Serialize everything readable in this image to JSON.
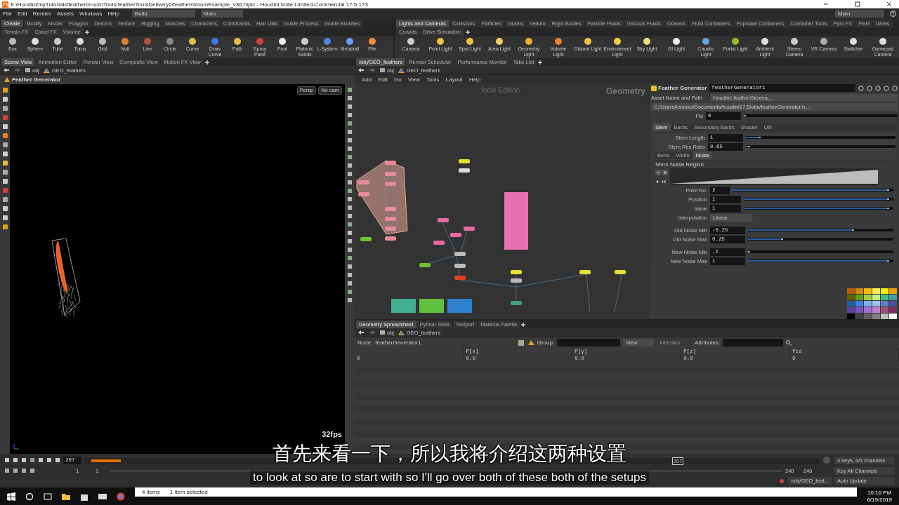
{
  "window": {
    "title": "E:/Houdini/myTutorials/featherGroomTools/featherToolsDelivery2/featherGroomExample_v36.hiplc - Houdini Indie Limited-Commercial 17.5.173"
  },
  "menu": [
    "File",
    "Edit",
    "Render",
    "Assets",
    "Windows",
    "Help"
  ],
  "desks": {
    "build": "Build",
    "main": "Main",
    "right": "Main"
  },
  "shelves": [
    {
      "tabs": [
        {
          "label": "Create",
          "selected": true
        },
        {
          "label": "Modify",
          "selected": false
        },
        {
          "label": "Model",
          "selected": false
        },
        {
          "label": "Polygon",
          "selected": false
        },
        {
          "label": "Deform",
          "selected": false
        },
        {
          "label": "Texture",
          "selected": false
        },
        {
          "label": "Rigging",
          "selected": false
        },
        {
          "label": "Muscles",
          "selected": false
        },
        {
          "label": "Characters",
          "selected": false
        },
        {
          "label": "Constraints",
          "selected": false
        },
        {
          "label": "Hair Utils",
          "selected": false
        },
        {
          "label": "Guide Process",
          "selected": false
        },
        {
          "label": "Guide Brushes",
          "selected": false
        },
        {
          "label": "Terrain FX",
          "selected": false
        },
        {
          "label": "Cloud FX",
          "selected": false
        },
        {
          "label": "Volume",
          "selected": false
        }
      ],
      "tools": [
        "Box",
        "Sphere",
        "Tube",
        "Torus",
        "Grid",
        "Null",
        "Line",
        "Circle",
        "Curve",
        "Draw Curve",
        "Path",
        "Spray Paint",
        "Font",
        "Platonic Solids",
        "L-System",
        "Metaball",
        "File"
      ]
    },
    {
      "tabs": [
        {
          "label": "Lights and Cameras",
          "selected": true
        },
        {
          "label": "Collisions",
          "selected": false
        },
        {
          "label": "Particles",
          "selected": false
        },
        {
          "label": "Grains",
          "selected": false
        },
        {
          "label": "Vellum",
          "selected": false
        },
        {
          "label": "Rigid Bodies",
          "selected": false
        },
        {
          "label": "Particle Fluids",
          "selected": false
        },
        {
          "label": "Viscous Fluids",
          "selected": false
        },
        {
          "label": "Oceans",
          "selected": false
        },
        {
          "label": "Fluid Containers",
          "selected": false
        },
        {
          "label": "Populate Containers",
          "selected": false
        },
        {
          "label": "Container Tools",
          "selected": false
        },
        {
          "label": "Pyro FX",
          "selected": false
        },
        {
          "label": "FEM",
          "selected": false
        },
        {
          "label": "Wires",
          "selected": false
        },
        {
          "label": "Crowds",
          "selected": false
        },
        {
          "label": "Drive Simulation",
          "selected": false
        }
      ],
      "tools": [
        "Camera",
        "Point Light",
        "Spot Light",
        "Area Light",
        "Geometry Light",
        "Volume Light",
        "Distant Light",
        "Environment Light",
        "Sky Light",
        "GI Light",
        "Caustic Light",
        "Portal Light",
        "Ambient Light",
        "Stereo Camera",
        "VR Camera",
        "Switcher",
        "Gamepad Camera"
      ]
    }
  ],
  "viewer": {
    "tabs": [
      {
        "label": "Scene View",
        "selected": true
      },
      {
        "label": "Animation Editor",
        "selected": false
      },
      {
        "label": "Render View",
        "selected": false
      },
      {
        "label": "Composite View",
        "selected": false
      },
      {
        "label": "Motion FX View",
        "selected": false
      }
    ],
    "path": [
      "obj",
      "GEO_feathers"
    ],
    "title": "Feather Generator",
    "camera": "Persp",
    "camera_menu": "No cam",
    "fps": "32fps"
  },
  "network": {
    "tabs": [
      {
        "label": "/obj/GEO_feathers",
        "selected": true
      },
      {
        "label": "Render Scheduler",
        "selected": false
      },
      {
        "label": "Performance Monitor",
        "selected": false
      },
      {
        "label": "Take List",
        "selected": false
      }
    ],
    "path": [
      "obj",
      "GEO_feathers"
    ],
    "menu": [
      "Add",
      "Edit",
      "Go",
      "View",
      "Tools",
      "Layout",
      "Help"
    ],
    "edition": "Indie Edition",
    "context": "Geometry"
  },
  "parameters": {
    "type": "Feather Generator",
    "name": "featherGenerator1",
    "asset": {
      "label": "Asset Name and Path",
      "name": "Houdini::featherGenera...",
      "path": "C:/Users/bsooko/Documents/houdini17.5/otls/featherGenerator.h..."
    },
    "fid": {
      "label": "Fid",
      "value": "0",
      "level": 0
    },
    "tabs": [
      {
        "label": "Stem",
        "selected": true
      },
      {
        "label": "Barbs",
        "selected": false
      },
      {
        "label": "Secondary Barbs",
        "selected": false
      },
      {
        "label": "Shader",
        "selected": false
      },
      {
        "label": "Util",
        "selected": false
      }
    ],
    "stem": [
      {
        "label": "Stem Length",
        "value": "1",
        "level": 0.1
      },
      {
        "label": "Stem Res Ratio",
        "value": "0.65",
        "level": 0.03
      }
    ],
    "subtabs": [
      {
        "label": "Bend",
        "selected": false
      },
      {
        "label": "Width",
        "selected": false
      },
      {
        "label": "Noise",
        "selected": true
      }
    ],
    "ramp": {
      "label": "Stem Noise Region"
    },
    "ramp_fields": [
      {
        "label": "Point No.",
        "value": "2",
        "level": 1
      },
      {
        "label": "Position",
        "value": "1",
        "level": 1
      },
      {
        "label": "Value",
        "value": "1",
        "level": 1
      }
    ],
    "interpolation": {
      "label": "Interpolation",
      "value": "Linear"
    },
    "noise": [
      {
        "label": "Old Noise Min",
        "value": "-0.25",
        "level": 0.75
      },
      {
        "label": "Old Noise Max",
        "value": "0.25",
        "level": 0.25
      },
      {
        "label": "New Noise Min",
        "value": "-1",
        "level": 0
      },
      {
        "label": "New Noise Max",
        "value": "1",
        "level": 1
      }
    ]
  },
  "spreadsheet": {
    "tabs": [
      {
        "label": "Geometry Spreadsheet",
        "selected": true
      },
      {
        "label": "Python Shell",
        "selected": false
      },
      {
        "label": "Textport",
        "selected": false
      },
      {
        "label": "Material Palette",
        "selected": false
      }
    ],
    "path": [
      "obj",
      "GEO_feathers"
    ],
    "node_label": "Node:",
    "node": "featherGenerator1",
    "group_label": "Group:",
    "view": "View",
    "intrinsics": "Intrinsics",
    "attributes_label": "Attributes:",
    "columns": [
      "P[x]",
      "P[y]",
      "P[z]",
      "fid"
    ],
    "rows": [
      {
        "index": "0",
        "cells": [
          "0.0",
          "0.0",
          "0.0",
          "0"
        ]
      }
    ]
  },
  "timeline": {
    "frame": "207",
    "marker": "207",
    "start": "1",
    "start_field": "1",
    "end": "240",
    "end_field": "240",
    "keys": "4 keys, 4/4 channels",
    "key_all": "Key All Channels",
    "path": "/obj/GEO_feat...",
    "update": "Auto Update"
  },
  "subtitles": {
    "chinese": "首先来看一下，所以我将介绍这两种设置",
    "english": "to look at so are to start with so I'll go over both of these both of the setups"
  },
  "explorer": {
    "items": "4 items",
    "selected": "1 item selected"
  },
  "taskbar": {
    "time": "10:16 PM",
    "date": "6/19/2019"
  }
}
